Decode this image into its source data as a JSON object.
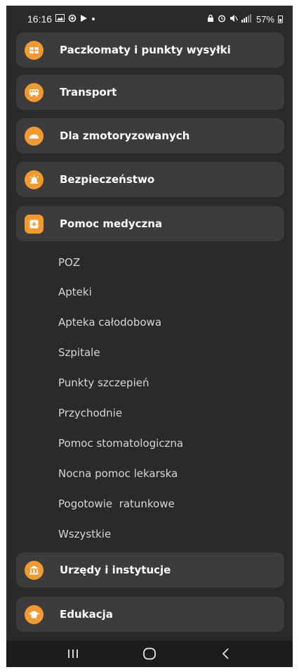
{
  "status_bar": {
    "time": "16:16",
    "battery": "57%",
    "left_icons": [
      "image-icon",
      "data-saver-icon",
      "play-icon",
      "dot"
    ],
    "right_icons": [
      "lock-icon",
      "alarm-icon",
      "mute-icon",
      "lte-icon",
      "signal-icon",
      "battery-icon"
    ]
  },
  "categories_top": [
    {
      "label": "Paczkomaty i punkty wysyłki",
      "icon": "parcel-locker-icon"
    },
    {
      "label": "Transport",
      "icon": "bus-icon"
    },
    {
      "label": "Dla zmotoryzowanych",
      "icon": "car-icon"
    },
    {
      "label": "Bezpieczeństwo",
      "icon": "siren-icon"
    },
    {
      "label": "Pomoc medyczna",
      "icon": "medical-cross-icon",
      "expanded": true
    }
  ],
  "medical_submenu": [
    "POZ",
    "Apteki",
    "Apteka całodobowa",
    "Szpitale",
    "Punkty szczepień",
    "Przychodnie",
    "Pomoc stomatologiczna",
    "Nocna pomoc lekarska",
    "Pogotowie  ratunkowe",
    "Wszystkie"
  ],
  "categories_bottom": [
    {
      "label": "Urzędy i instytucje",
      "icon": "government-building-icon"
    },
    {
      "label": "Edukacja",
      "icon": "graduation-cap-icon"
    }
  ],
  "nav_bar": {
    "buttons": [
      "recent-apps",
      "home",
      "back"
    ]
  },
  "colors": {
    "background": "#2a2a2c",
    "card": "#3c3c3e",
    "accent": "#f39a2e",
    "text": "#ffffff",
    "subtext": "#d6d6d6"
  }
}
